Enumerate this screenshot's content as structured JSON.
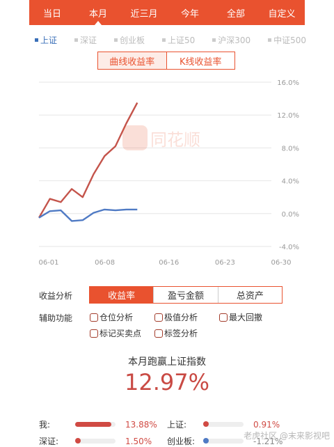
{
  "tabs": [
    "当日",
    "本月",
    "近三月",
    "今年",
    "全部",
    "自定义"
  ],
  "active_tab": 1,
  "indices": [
    {
      "label": "上证",
      "active": true
    },
    {
      "label": "深证",
      "active": false
    },
    {
      "label": "创业板",
      "active": false
    },
    {
      "label": "上证50",
      "active": false
    },
    {
      "label": "沪深300",
      "active": false
    },
    {
      "label": "中证500",
      "active": false
    }
  ],
  "curve_toggle": {
    "left": "曲线收益率",
    "right": "K线收益率"
  },
  "watermark": "同花顺",
  "chart_data": {
    "type": "line",
    "y_ticks": [
      "16.0%",
      "12.0%",
      "8.0%",
      "4.0%",
      "0.0%",
      "-4.0%"
    ],
    "ylim": [
      -4,
      16
    ],
    "x_ticks": [
      "06-01",
      "06-08",
      "06-16",
      "06-23",
      "06-30"
    ],
    "x_tick_days": [
      1,
      8,
      16,
      23,
      30
    ],
    "series": [
      {
        "color": "#c4544b",
        "x": [
          0,
          1,
          2,
          3,
          4,
          5,
          6,
          7,
          8,
          9
        ],
        "y": [
          -0.5,
          1.8,
          1.4,
          3.0,
          2.0,
          4.8,
          7.0,
          8.2,
          11.0,
          13.5
        ]
      },
      {
        "color": "#4f7ac4",
        "x": [
          0,
          1,
          2,
          3,
          4,
          5,
          6,
          7,
          8,
          9
        ],
        "y": [
          -0.5,
          0.3,
          0.4,
          -0.9,
          -0.8,
          0.1,
          0.5,
          0.4,
          0.5,
          0.5
        ]
      }
    ]
  },
  "analysis": {
    "label": "收益分析",
    "tabs": [
      "收益率",
      "盈亏金额",
      "总资产"
    ]
  },
  "aux": {
    "label": "辅助功能",
    "items": [
      "仓位分析",
      "极值分析",
      "最大回撤",
      "标记买卖点",
      "标签分析"
    ]
  },
  "summary": {
    "title": "本月跑赢上证指数",
    "value": "12.97%"
  },
  "stats": [
    {
      "label": "我:",
      "value": "13.88%",
      "fill": 0.9,
      "kind": "bar",
      "color": "#d04a43"
    },
    {
      "label": "上证:",
      "value": "0.91%",
      "fill": 0.06,
      "kind": "dot",
      "color": "#d04a43"
    },
    {
      "label": "深证:",
      "value": "1.50%",
      "fill": 0.1,
      "kind": "dot",
      "color": "#d04a43"
    },
    {
      "label": "创业板:",
      "value": "-1.21%",
      "fill": 0.08,
      "kind": "dot",
      "color": "#4f7ac4"
    }
  ],
  "branding": "老虎社区 @末来影视吧"
}
